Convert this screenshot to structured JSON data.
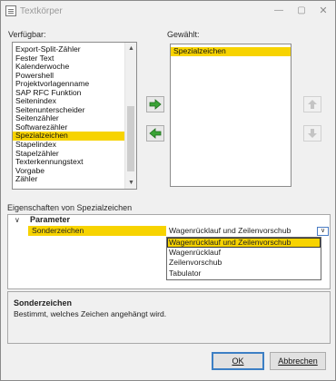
{
  "window": {
    "title": "Textkörper",
    "controls": {
      "minimize": "—",
      "maximize": "▢",
      "close": "✕"
    }
  },
  "available": {
    "label": "Verfügbar:",
    "items": [
      "Export-Split-Zähler",
      "Fester Text",
      "Kalenderwoche",
      "Powershell",
      "Projektvorlagenname",
      "SAP RFC Funktion",
      "Seitenindex",
      "Seitenunterscheider",
      "Seitenzähler",
      "Softwarezähler",
      "Spezialzeichen",
      "Stapelindex",
      "Stapelzähler",
      "Texterkennungstext",
      "Vorgabe",
      "Zähler"
    ],
    "selected_index": 10
  },
  "selected": {
    "label": "Gewählt:",
    "items": [
      "Spezialzeichen"
    ]
  },
  "properties": {
    "label": "Eigenschaften von Spezialzeichen",
    "group": "Parameter",
    "row_name": "Sonderzeichen",
    "row_value": "Wagenrücklauf und Zeilenvorschub",
    "options": [
      "Wagenrücklauf und Zeilenvorschub",
      "Wagenrücklauf",
      "Zeilenvorschub",
      "Tabulator"
    ],
    "selected_option_index": 0
  },
  "description": {
    "title": "Sonderzeichen",
    "text": "Bestimmt, welches Zeichen angehängt wird."
  },
  "buttons": {
    "ok": "OK",
    "cancel": "Abbrechen"
  },
  "colors": {
    "selection": "#f7d300",
    "arrow_green": "#3aa336",
    "focus_blue": "#3c7fc4"
  }
}
